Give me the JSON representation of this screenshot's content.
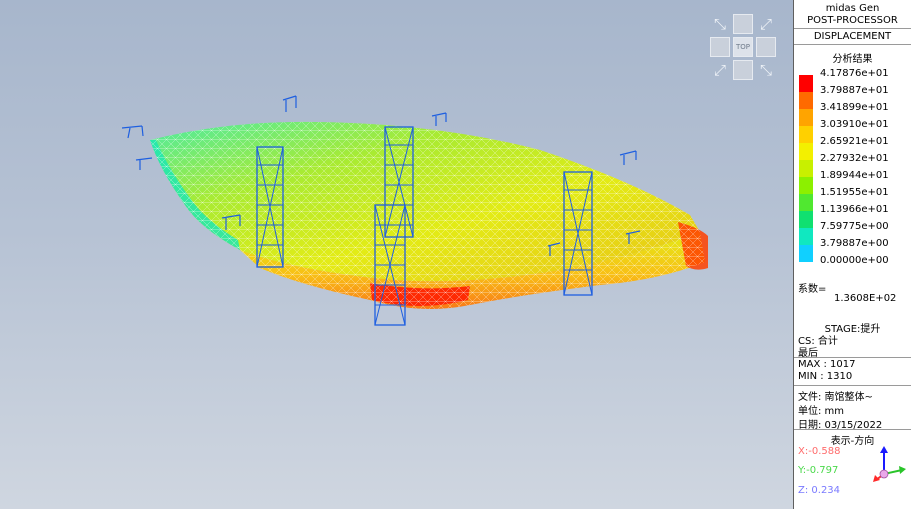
{
  "panel": {
    "app_name": "midas Gen",
    "module": "POST-PROCESSOR",
    "result_type": "DISPLACEMENT",
    "legend_title": "分析结果",
    "legend_values": [
      "4.17876e+01",
      "3.79887e+01",
      "3.41899e+01",
      "3.03910e+01",
      "2.65921e+01",
      "2.27932e+01",
      "1.89944e+01",
      "1.51955e+01",
      "1.13966e+01",
      "7.59775e+00",
      "3.79887e+00",
      "0.00000e+00"
    ],
    "legend_colors": [
      "#ff0000",
      "#ff6a00",
      "#ffa400",
      "#ffd000",
      "#f3f000",
      "#c8f000",
      "#8cf000",
      "#50e830",
      "#10e070",
      "#10e8c0",
      "#10d0ff",
      "#1010ff"
    ],
    "factor_label": "系数=",
    "factor_value": "1.3608E+02",
    "stage": "STAGE:提升",
    "cs": "CS: 合计",
    "step": "最后",
    "max": "MAX : 1017",
    "min": "MIN : 1310",
    "file": "文件: 南馆整体~",
    "unit": "单位: mm",
    "date": "日期: 03/15/2022",
    "direction_title": "表示-方向",
    "dir_x": "X:-0.588",
    "dir_y": "Y:-0.797",
    "dir_z": "Z: 0.234"
  },
  "viewcube": {
    "top_label": "TOP"
  },
  "colors": {
    "dir_x": "#ff6b6b",
    "dir_y": "#4ad94a",
    "dir_z": "#7a7aff",
    "tower": "#1e5fe0"
  }
}
